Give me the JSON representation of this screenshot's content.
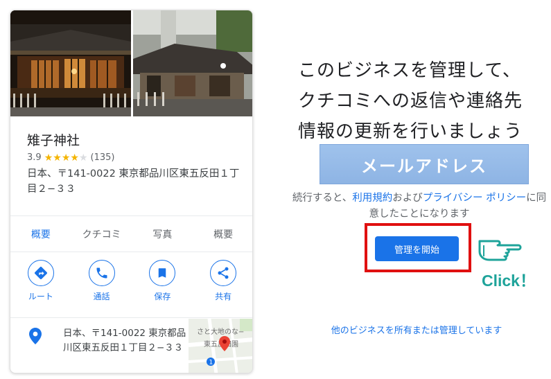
{
  "business": {
    "name": "雉子神社",
    "rating": "3.9",
    "stars": 4,
    "review_count": "(135)",
    "address": "日本、〒141-0022 東京都品川区東五反田１丁目２−３３"
  },
  "tabs": [
    "概要",
    "クチコミ",
    "写真",
    "概要"
  ],
  "actions": [
    {
      "label": "ルート",
      "icon": "directions-icon"
    },
    {
      "label": "通話",
      "icon": "phone-icon"
    },
    {
      "label": "保存",
      "icon": "bookmark-icon"
    },
    {
      "label": "共有",
      "icon": "share-icon"
    }
  ],
  "address_detail": "日本、〒141-0022 東京都品川区東五反田１丁目２−３３",
  "minimap": {
    "label_1": "さと大地のな−",
    "label_2": "東五反田園",
    "route_badge": "1"
  },
  "right": {
    "headline_1": "このビジネスを管理して、",
    "headline_2": "クチコミへの返信や連絡先",
    "headline_3": "情報の更新を行いましょう",
    "email_button": "メールアドレス",
    "terms_pre": "続行すると、",
    "terms_link1": "利用規約",
    "terms_mid": "および",
    "terms_link2": "プライバシー ポリシー",
    "terms_post": "に同意したことになります",
    "start_button": "管理を開始",
    "click_text": "Click！",
    "other_link": "他のビジネスを所有または管理しています"
  },
  "colors": {
    "accent": "#1a73e8",
    "highlight_box": "#e01010",
    "click_teal": "#1ea39a",
    "star": "#f4b400"
  }
}
